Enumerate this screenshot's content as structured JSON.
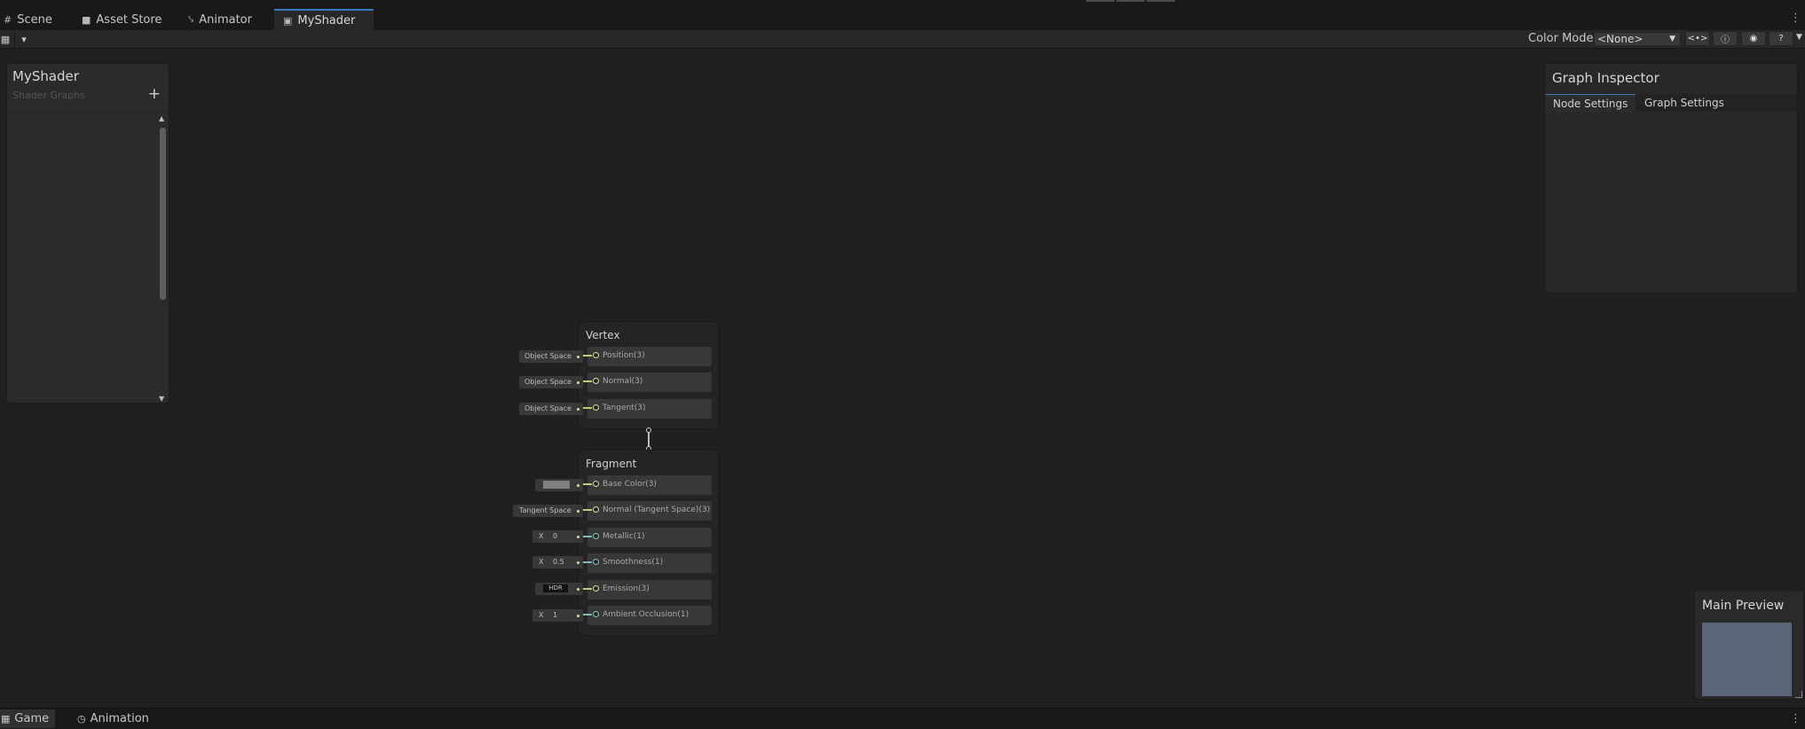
{
  "top_tabs": [
    {
      "label": "Scene",
      "icon": "grid-icon"
    },
    {
      "label": "Asset Store",
      "icon": "bag-icon"
    },
    {
      "label": "Animator",
      "icon": "animator-icon"
    },
    {
      "label": "MyShader",
      "icon": "shader-graph-icon",
      "active": true
    }
  ],
  "toolbar": {
    "save_icon": "save-icon",
    "dropdown_icon": "chevron-down-icon",
    "color_mode_label": "Color Mode",
    "color_mode_value": "<None>",
    "buttons": [
      "code-icon",
      "info-icon",
      "sphere-icon",
      "help-icon"
    ]
  },
  "blackboard": {
    "title": "MyShader",
    "subtitle": "Shader Graphs",
    "add_label": "+"
  },
  "inspector": {
    "title": "Graph Inspector",
    "tabs": [
      "Node Settings",
      "Graph Settings"
    ],
    "active_tab": "Node Settings"
  },
  "vertex": {
    "title": "Vertex",
    "slots": [
      {
        "label": "Position(3)",
        "input": "Object Space"
      },
      {
        "label": "Normal(3)",
        "input": "Object Space"
      },
      {
        "label": "Tangent(3)",
        "input": "Object Space"
      }
    ]
  },
  "fragment": {
    "title": "Fragment",
    "slots": [
      {
        "label": "Base Color(3)",
        "input_kind": "color",
        "color": "#7f7f7f"
      },
      {
        "label": "Normal (Tangent Space)(3)",
        "input_kind": "text",
        "input": "Tangent Space"
      },
      {
        "label": "Metallic(1)",
        "input_kind": "float",
        "axis": "X",
        "value": "0"
      },
      {
        "label": "Smoothness(1)",
        "input_kind": "float",
        "axis": "X",
        "value": "0.5"
      },
      {
        "label": "Emission(3)",
        "input_kind": "hdr",
        "input": "HDR"
      },
      {
        "label": "Ambient Occlusion(1)",
        "input_kind": "float",
        "axis": "X",
        "value": "1"
      }
    ]
  },
  "preview": {
    "title": "Main Preview"
  },
  "bottom_tabs": [
    {
      "label": "Game",
      "icon": "gamepad-icon",
      "active": true
    },
    {
      "label": "Animation",
      "icon": "clock-icon"
    }
  ],
  "colors": {
    "accent": "#3a79bb",
    "vector3_port": "#dde19a",
    "float_port": "#85c9c9",
    "preview_fill": "#5c6477"
  }
}
